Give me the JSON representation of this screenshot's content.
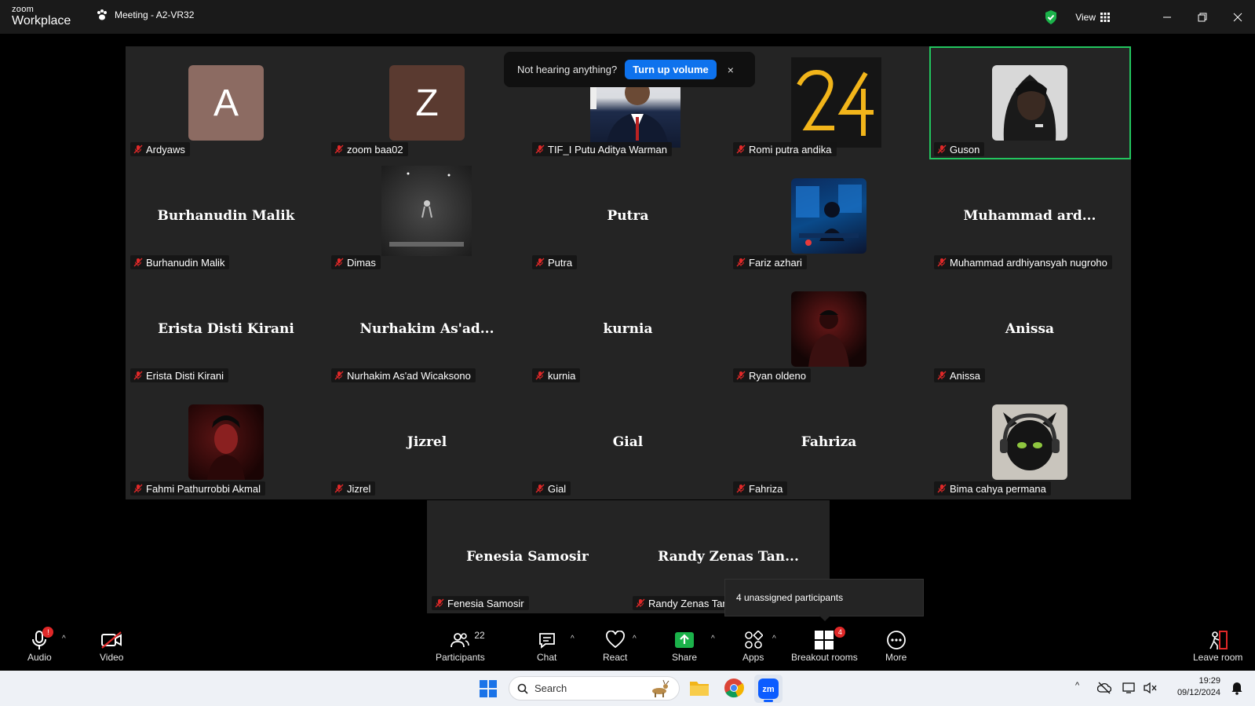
{
  "app": {
    "brand_top": "zoom",
    "brand_bottom": "Workplace",
    "meeting_title": "Meeting - A2-VR32",
    "view_label": "View"
  },
  "notification": {
    "message": "Not hearing anything?",
    "button": "Turn up volume",
    "close": "×"
  },
  "participants": [
    {
      "tile_name": "Ardyaws",
      "label": "Ardyaws",
      "avatar": "letter",
      "letter": "A",
      "color": "#8c6b62"
    },
    {
      "tile_name": "zoom baa02",
      "label": "zoom baa02",
      "avatar": "letter",
      "letter": "Z",
      "color": "#5a3a30"
    },
    {
      "tile_name": "TIF_I Putu Aditya Warman",
      "label": "TIF_I Putu Aditya Warman",
      "avatar": "photo"
    },
    {
      "tile_name": "Romi putra andika",
      "label": "Romi putra andika",
      "avatar": "photo"
    },
    {
      "tile_name": "Guson",
      "label": "Guson",
      "avatar": "photo",
      "active": true
    },
    {
      "tile_name": "Burhanudin Malik",
      "label": "Burhanudin Malik",
      "avatar": "none"
    },
    {
      "tile_name": "Dimas",
      "label": "Dimas",
      "avatar": "photo"
    },
    {
      "tile_name": "Putra",
      "label": "Putra",
      "avatar": "none"
    },
    {
      "tile_name": "Fariz azhari",
      "label": "Fariz azhari",
      "avatar": "photo"
    },
    {
      "tile_name": "Muhammad  ard...",
      "label": "Muhammad ardhiyansyah nugroho",
      "avatar": "none"
    },
    {
      "tile_name": "Erista Disti Kirani",
      "label": "Erista Disti Kirani",
      "avatar": "none"
    },
    {
      "tile_name": "Nurhakim  As'ad...",
      "label": "Nurhakim As'ad Wicaksono",
      "avatar": "none"
    },
    {
      "tile_name": "kurnia",
      "label": "kurnia",
      "avatar": "none"
    },
    {
      "tile_name": "Ryan oldeno",
      "label": "Ryan oldeno",
      "avatar": "photo"
    },
    {
      "tile_name": "Anissa",
      "label": "Anissa",
      "avatar": "none"
    },
    {
      "tile_name": "Fahmi Pathurrobbi Akmal",
      "label": "Fahmi Pathurrobbi Akmal",
      "avatar": "photo"
    },
    {
      "tile_name": "Jizrel",
      "label": "Jizrel",
      "avatar": "none"
    },
    {
      "tile_name": "Gial",
      "label": "Gial",
      "avatar": "none"
    },
    {
      "tile_name": "Fahriza",
      "label": "Fahriza",
      "avatar": "none"
    },
    {
      "tile_name": "Bima cahya permana",
      "label": "Bima cahya permana",
      "avatar": "photo"
    },
    {
      "tile_name": "Fenesia Samosir",
      "label": "Fenesia Samosir",
      "avatar": "none"
    },
    {
      "tile_name": "Randy  Zenas  Tan...",
      "label": "Randy Zenas Tan",
      "avatar": "none"
    }
  ],
  "tooltip": "4 unassigned participants",
  "toolbar": {
    "audio": "Audio",
    "audio_badge": "!",
    "video": "Video",
    "participants": "Participants",
    "participants_count": "22",
    "chat": "Chat",
    "react": "React",
    "share": "Share",
    "apps": "Apps",
    "breakout": "Breakout rooms",
    "breakout_badge": "4",
    "more": "More",
    "leave": "Leave room"
  },
  "taskbar": {
    "search_placeholder": "Search",
    "time": "19:29",
    "date": "09/12/2024"
  },
  "colors": {
    "active_border": "#22c55e",
    "primary_button": "#0e72ed",
    "share_green": "#1bb24a",
    "badge_red": "#e02828"
  }
}
